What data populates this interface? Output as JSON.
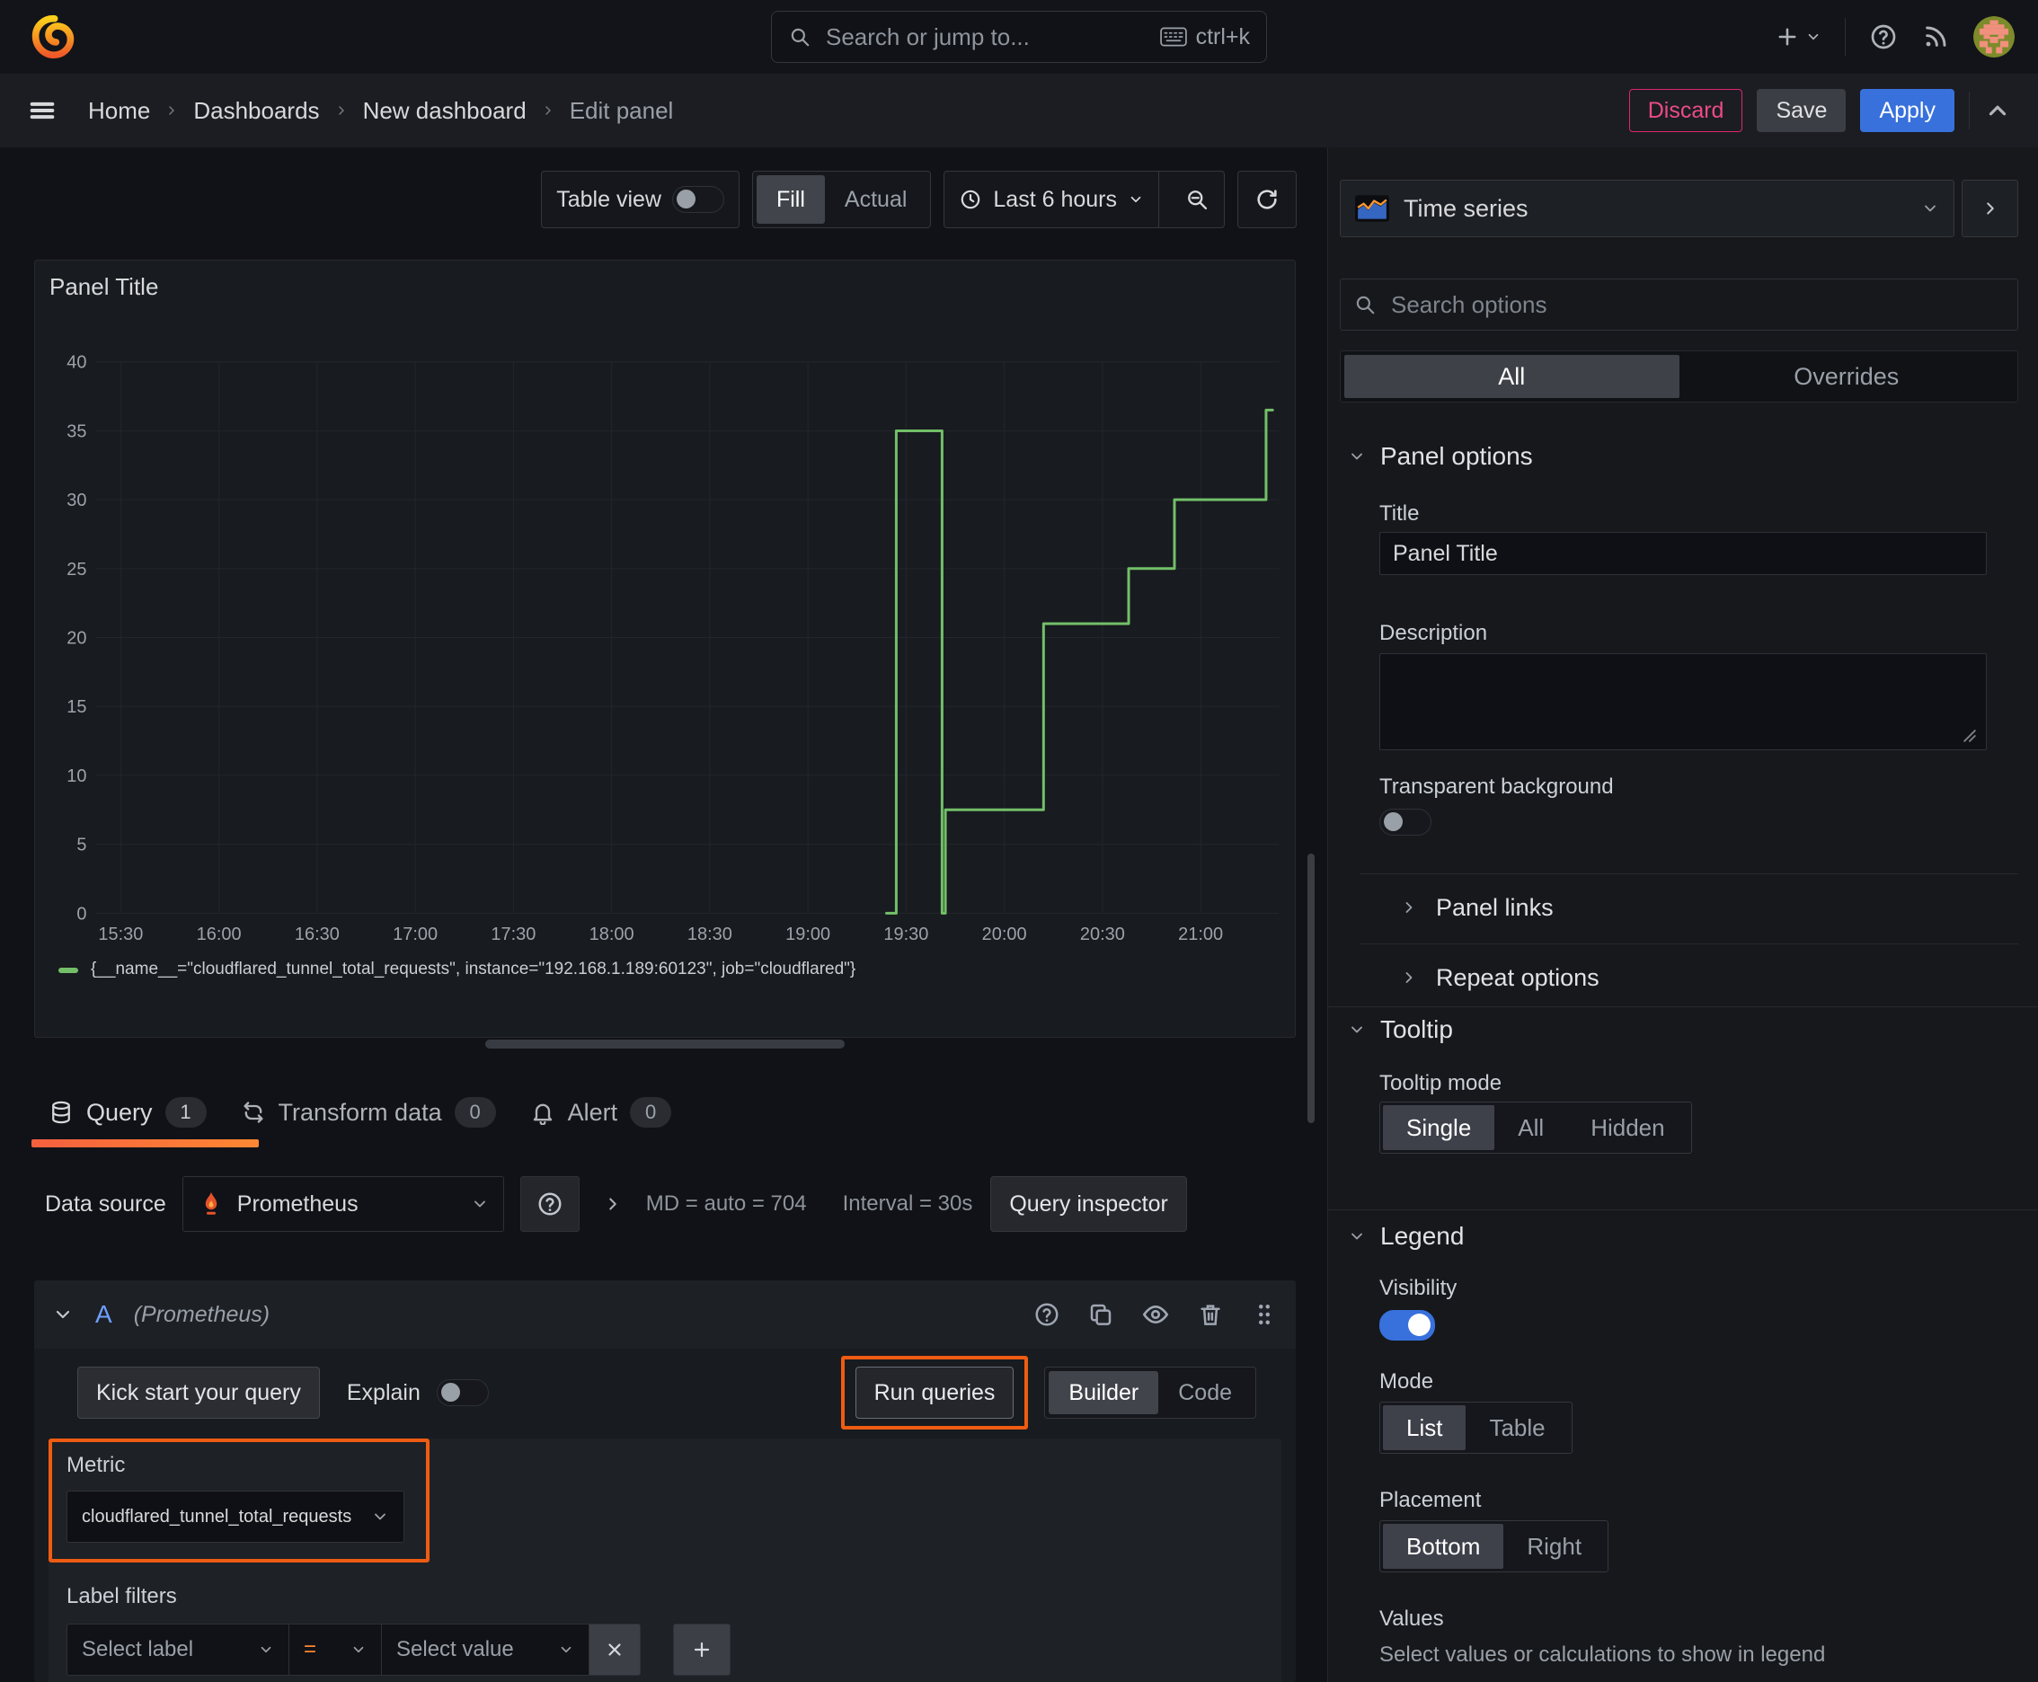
{
  "topbar": {
    "search_placeholder": "Search or jump to...",
    "shortcut": "ctrl+k"
  },
  "nav": {
    "breadcrumbs": [
      "Home",
      "Dashboards",
      "New dashboard",
      "Edit panel"
    ],
    "discard": "Discard",
    "save": "Save",
    "apply": "Apply"
  },
  "toolbar": {
    "table_view": "Table view",
    "fill": "Fill",
    "actual": "Actual",
    "time_range": "Last 6 hours"
  },
  "panel": {
    "title": "Panel Title"
  },
  "chart_data": {
    "type": "line",
    "line_style": "step",
    "title": "Panel Title",
    "color": "#73bf69",
    "grid": true,
    "legend_position": "bottom",
    "x_ticks": [
      "15:30",
      "16:00",
      "16:30",
      "17:00",
      "17:30",
      "18:00",
      "18:30",
      "19:00",
      "19:30",
      "20:00",
      "20:30",
      "21:00"
    ],
    "y_ticks": [
      0,
      5,
      10,
      15,
      20,
      25,
      30,
      35,
      40
    ],
    "ylim": [
      0,
      40
    ],
    "series": [
      {
        "name": "{__name__=\"cloudflared_tunnel_total_requests\", instance=\"192.168.1.189:60123\", job=\"cloudflared\"}",
        "steps": [
          {
            "t": "19:24",
            "v": 0
          },
          {
            "t": "19:27",
            "v": 35
          },
          {
            "t": "19:41",
            "v": 0
          },
          {
            "t": "19:42",
            "v": 7.5
          },
          {
            "t": "20:12",
            "v": 21
          },
          {
            "t": "20:38",
            "v": 25
          },
          {
            "t": "20:52",
            "v": 30
          },
          {
            "t": "21:20",
            "v": 36.5
          },
          {
            "t": "21:22",
            "v": 36.5
          }
        ]
      }
    ]
  },
  "tabs": {
    "query": "Query",
    "query_count": "1",
    "transform": "Transform data",
    "transform_count": "0",
    "alert": "Alert",
    "alert_count": "0"
  },
  "query": {
    "datasource_label": "Data source",
    "datasource": "Prometheus",
    "stats_md": "MD = auto = 704",
    "stats_interval": "Interval = 30s",
    "inspector": "Query inspector",
    "ref_id": "A",
    "ref_ds": "(Prometheus)",
    "kickstart": "Kick start your query",
    "explain": "Explain",
    "run_queries": "Run queries",
    "builder": "Builder",
    "code": "Code",
    "metric_label": "Metric",
    "metric_value": "cloudflared_tunnel_total_requests",
    "label_filters": "Label filters",
    "select_label": "Select label",
    "operator": "=",
    "select_value": "Select value"
  },
  "options": {
    "viz_name": "Time series",
    "search_placeholder": "Search options",
    "tab_all": "All",
    "tab_overrides": "Overrides",
    "panel_options": "Panel options",
    "title_label": "Title",
    "title_value": "Panel Title",
    "description_label": "Description",
    "transparent_label": "Transparent background",
    "panel_links": "Panel links",
    "repeat_options": "Repeat options",
    "tooltip_header": "Tooltip",
    "tooltip_mode_label": "Tooltip mode",
    "tooltip_single": "Single",
    "tooltip_all": "All",
    "tooltip_hidden": "Hidden",
    "legend_header": "Legend",
    "visibility_label": "Visibility",
    "mode_label": "Mode",
    "mode_list": "List",
    "mode_table": "Table",
    "placement_label": "Placement",
    "placement_bottom": "Bottom",
    "placement_right": "Right",
    "values_label": "Values",
    "values_hint": "Select values or calculations to show in legend"
  },
  "colors": {
    "accent_blue": "#3871dc",
    "series_green": "#73bf69",
    "highlight_orange": "#ee5c13",
    "discard_red": "#e0246f",
    "tab_underline_orange": "#ff8833",
    "prometheus_orange": "#e6522c"
  }
}
